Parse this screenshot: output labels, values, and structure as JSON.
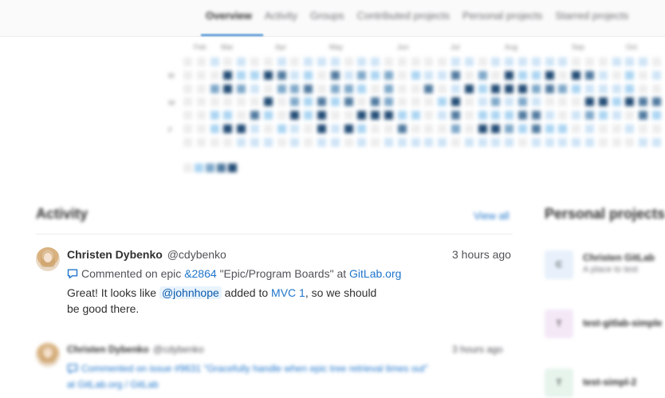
{
  "tabs": [
    "Overview",
    "Activity",
    "Groups",
    "Contributed projects",
    "Personal projects",
    "Starred projects"
  ],
  "calendar": {
    "months": [
      "Feb",
      "Mar",
      "Apr",
      "May",
      "Jun",
      "Jul",
      "Aug",
      "Sep",
      "Oct"
    ],
    "days": [
      "M",
      "W",
      "F"
    ]
  },
  "activity": {
    "title": "Activity",
    "view_all": "View all",
    "events": [
      {
        "name": "Christen Dybenko",
        "handle": "@cdybenko",
        "time": "3 hours ago",
        "action_prefix": "Commented on epic",
        "target_ref": "&2864",
        "target_title": "\"Epic/Program Boards\" at",
        "target_group": "GitLab.org",
        "body_prefix": "Great! It looks like",
        "mention": "@johnhope",
        "body_mid": "added to",
        "body_link": "MVC 1",
        "body_suffix": ", so we should be good there."
      },
      {
        "name": "Christen Dybenko",
        "handle": "@cdybenko",
        "time": "3 hours ago",
        "action_prefix": "Commented on issue",
        "target_ref": "#9631",
        "target_title": "\"Gracefully handle when epic tree retrieval times out\"",
        "target_group": "at GitLab.org / GitLab"
      }
    ]
  },
  "personal_projects": {
    "title": "Personal projects",
    "items": [
      {
        "initial": "C",
        "name": "Christen GitLab",
        "desc": "A place to test",
        "tile_color": "#e7f0fb"
      },
      {
        "initial": "T",
        "name": "test-gitlab-simple",
        "desc": "",
        "tile_color": "#f4e8f7"
      },
      {
        "initial": "T",
        "name": "test-simpl-2",
        "desc": "",
        "tile_color": "#e6f4ec"
      }
    ]
  }
}
